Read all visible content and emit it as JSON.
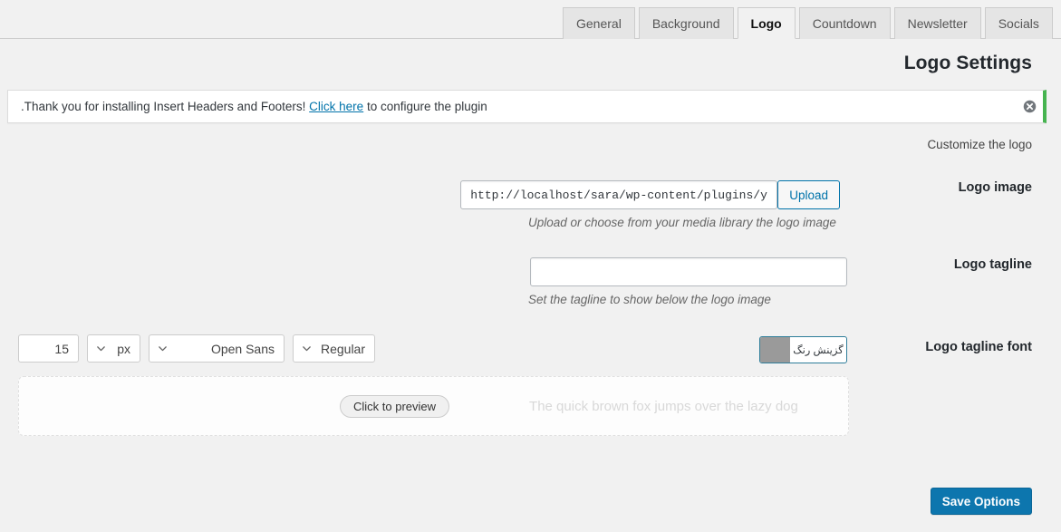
{
  "tabs": [
    {
      "label": "Socials",
      "active": false
    },
    {
      "label": "Newsletter",
      "active": false
    },
    {
      "label": "Countdown",
      "active": false
    },
    {
      "label": "Logo",
      "active": true
    },
    {
      "label": "Background",
      "active": false
    },
    {
      "label": "General",
      "active": false
    }
  ],
  "header": {
    "title": "Logo Settings",
    "subtitle": "Customize the logo"
  },
  "notice": {
    "text_before_link": ".Thank you for installing Insert Headers and Footers! ",
    "link_label": "Click here",
    "text_after_link": " to configure the plugin",
    "dismiss_icon": "dismiss-circle-x-icon",
    "accent_color": "#46b450"
  },
  "fields": {
    "logo_image": {
      "label": "Logo image",
      "upload_label": "Upload",
      "value": "http://localhost/sara/wp-content/plugins/yi",
      "placeholder": "",
      "hint": "Upload or choose from your media library the logo image"
    },
    "logo_tagline": {
      "label": "Logo tagline",
      "value": "",
      "placeholder": "",
      "hint": "Set the tagline to show below the logo image"
    },
    "logo_tagline_font": {
      "label": "Logo tagline font",
      "size_value": "15",
      "unit_value": "px",
      "family_value": "Open Sans",
      "weight_value": "Regular",
      "color_picker_label": "گزینش رنگ",
      "color_swatch": "#9a9a9a",
      "chevron_icon": "chevron-down-icon"
    }
  },
  "preview": {
    "button_label": "Click to preview",
    "sample_text": "The quick brown fox jumps over the lazy dog"
  },
  "footer": {
    "save_label": "Save Options",
    "save_color": "#0d76ae"
  }
}
